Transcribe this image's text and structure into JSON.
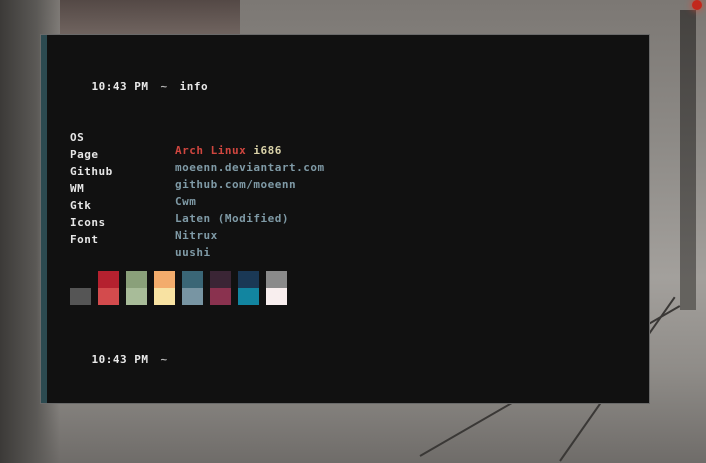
{
  "terminal": {
    "prompt1": {
      "time": "10:43 PM",
      "tilde": "~",
      "command": "info"
    },
    "info": [
      {
        "label": "OS",
        "value": "Arch Linux",
        "value_extra": "i686"
      },
      {
        "label": "Page",
        "value": "moeenn.deviantart.com"
      },
      {
        "label": "Github",
        "value": "github.com/moeenn"
      },
      {
        "label": "WM",
        "value": "Cwm"
      },
      {
        "label": "Gtk",
        "value": "Laten (Modified)"
      },
      {
        "label": "Icons",
        "value": "Nitrux"
      },
      {
        "label": "Font",
        "value": "uushi"
      }
    ],
    "prompt2": {
      "time": "10:43 PM",
      "tilde": "~"
    }
  },
  "palette": {
    "top": [
      "#111111",
      "#b5212f",
      "#8aa07a",
      "#f3ac6c",
      "#3a6676",
      "#3a2535",
      "#1a3855",
      "#8a8a8a"
    ],
    "bottom": [
      "#555555",
      "#d34b4d",
      "#a8bc99",
      "#f8e2a2",
      "#7895a3",
      "#8a324f",
      "#1285a0",
      "#f8eeee"
    ]
  }
}
